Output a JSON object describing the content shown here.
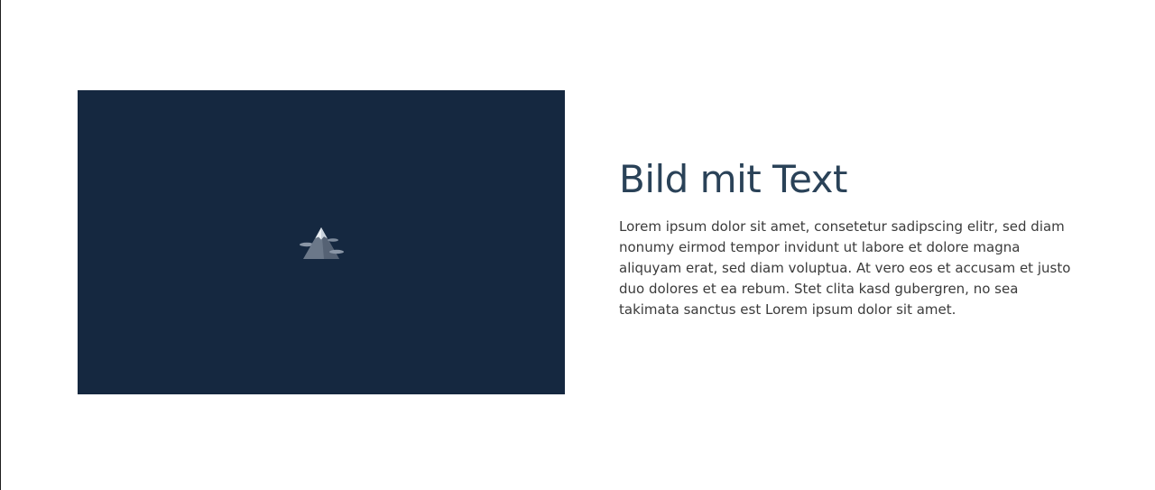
{
  "section": {
    "image": {
      "background_color": "#152840",
      "icon": "mountain-placeholder-icon"
    },
    "heading": "Bild mit Text",
    "paragraph": "Lorem ipsum dolor sit amet, consetetur sadipscing elitr, sed diam nonumy eirmod tempor invidunt ut labore et dolore magna aliquyam erat, sed diam voluptua. At vero eos et accusam et justo duo dolores et ea rebum. Stet clita kasd gubergren, no sea takimata sanctus est Lorem ipsum dolor sit amet."
  }
}
